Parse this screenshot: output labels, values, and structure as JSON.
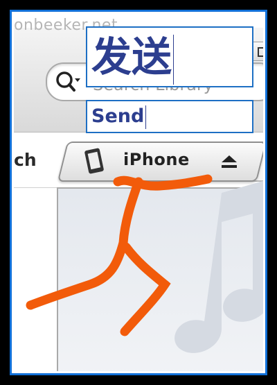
{
  "header": {
    "url_fragment": "onbeeker.net"
  },
  "search": {
    "placeholder": "Search Library"
  },
  "overlay": {
    "chinese_text": "发送",
    "english_text": "Send"
  },
  "tabs": {
    "left_partial_label": "ch",
    "device_tab_label": "iPhone"
  },
  "icons": {
    "search": "magnifier-icon",
    "phone": "iphone-icon",
    "eject": "eject-icon",
    "note": "music-note-icon"
  },
  "colors": {
    "frame_border": "#1170d8",
    "overlay_text": "#2c3e8f",
    "overlay_border": "#1d6fc4",
    "scribble": "#f25b0a"
  }
}
